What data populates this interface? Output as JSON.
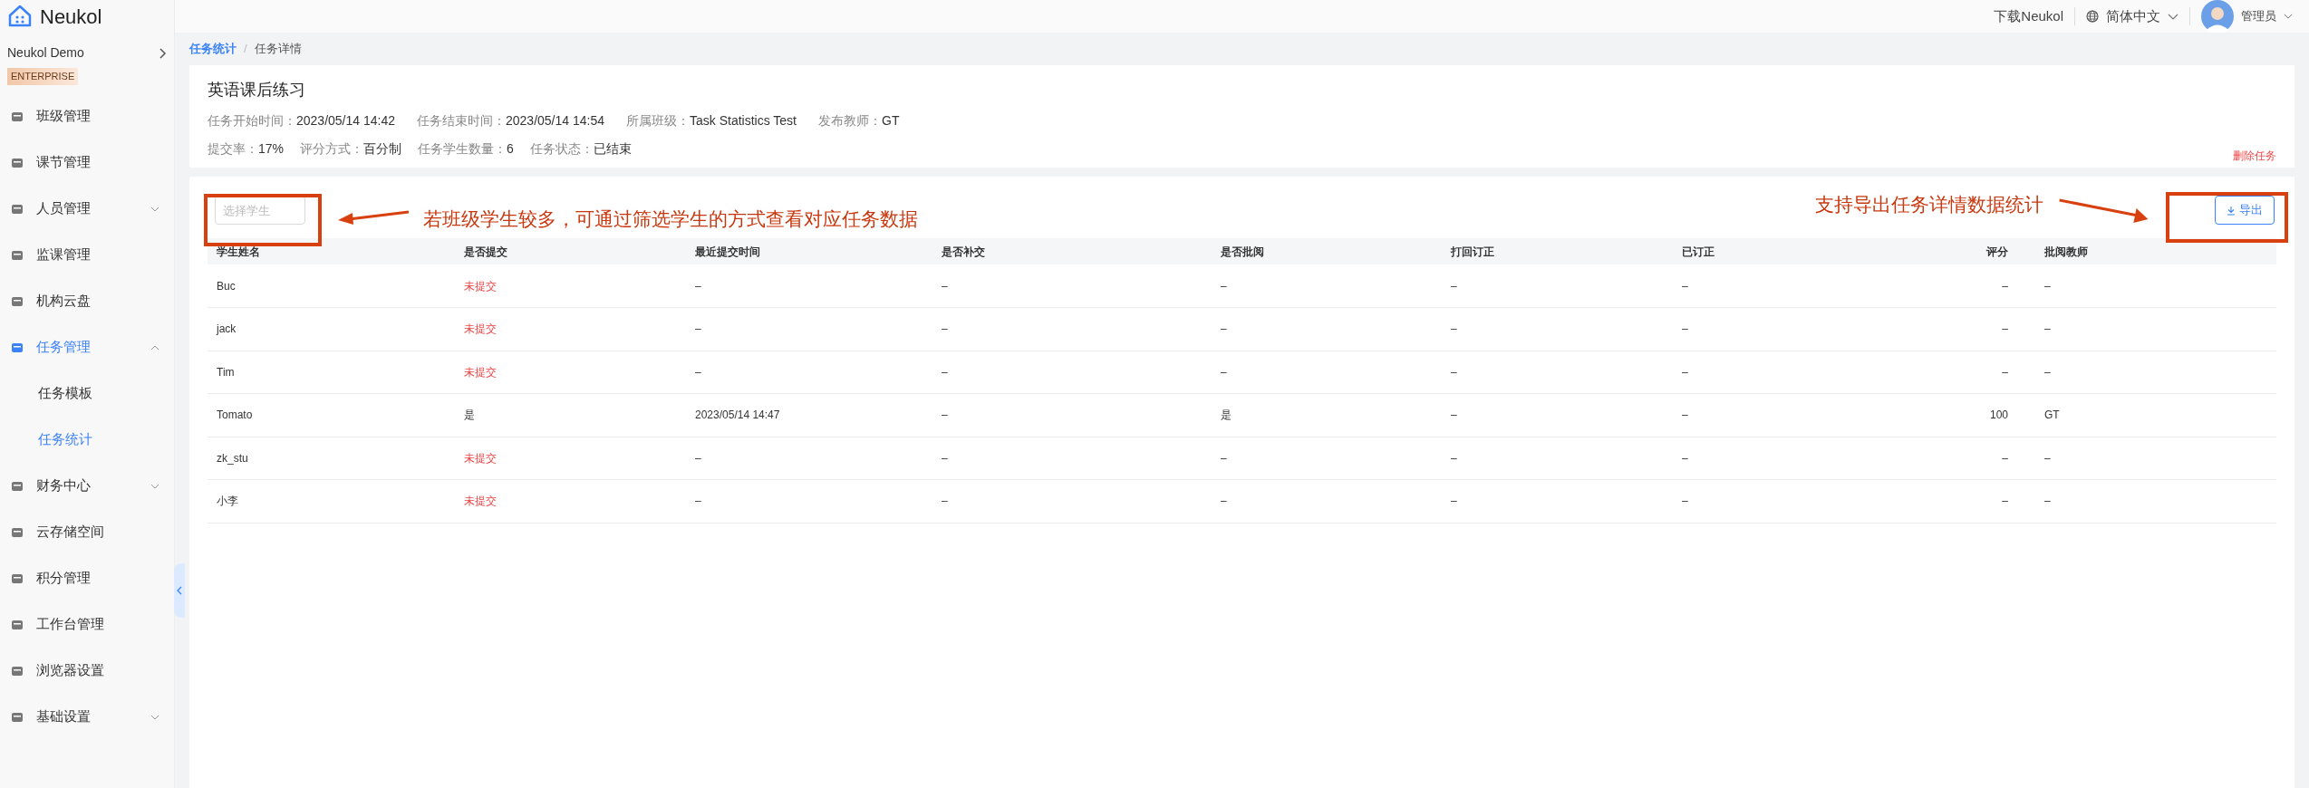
{
  "app": {
    "logo_text": "Neukol",
    "org_name": "Neukol Demo",
    "org_badge": "ENTERPRISE"
  },
  "header": {
    "download_link": "下载Neukol",
    "language": "简体中文",
    "user": "管理员"
  },
  "sidebar": {
    "items": [
      {
        "kind": "link",
        "label": "班级管理",
        "selected": false
      },
      {
        "kind": "link",
        "label": "课节管理",
        "selected": false
      },
      {
        "kind": "group",
        "label": "人员管理",
        "expanded": false
      },
      {
        "kind": "link",
        "label": "监课管理",
        "selected": false
      },
      {
        "kind": "link",
        "label": "机构云盘",
        "selected": false
      },
      {
        "kind": "group",
        "label": "任务管理",
        "expanded": true,
        "children": [
          {
            "label": "任务模板",
            "selected": false
          },
          {
            "label": "任务统计",
            "selected": true
          }
        ]
      },
      {
        "kind": "group",
        "label": "财务中心",
        "expanded": false
      },
      {
        "kind": "link",
        "label": "云存储空间",
        "selected": false
      },
      {
        "kind": "link",
        "label": "积分管理",
        "selected": false
      },
      {
        "kind": "link",
        "label": "工作台管理",
        "selected": false
      },
      {
        "kind": "link",
        "label": "浏览器设置",
        "selected": false
      },
      {
        "kind": "group",
        "label": "基础设置",
        "expanded": false
      }
    ]
  },
  "breadcrumb_separator": "/",
  "breadcrumb": [
    {
      "label": "任务统计",
      "selected": false
    },
    {
      "label": "任务详情",
      "selected": true
    }
  ],
  "task": {
    "title": "英语课后练习",
    "fields_line_1": [
      {
        "label": "任务开始时间：",
        "value": "2023/05/14 14:42"
      },
      {
        "label": "任务结束时间：",
        "value": "2023/05/14 14:54"
      },
      {
        "label": "所属班级：",
        "value": "Task Statistics Test"
      },
      {
        "label": "发布教师：",
        "value": "GT"
      }
    ],
    "fields_line_2": [
      {
        "label": "提交率：",
        "value": "17%"
      },
      {
        "label": "评分方式：",
        "value": "百分制"
      },
      {
        "label": "任务学生数量：",
        "value": "6"
      },
      {
        "label": "任务状态：",
        "value": "已结束"
      }
    ],
    "delete_link": "删除任务"
  },
  "filter": {
    "placeholder": "选择学生"
  },
  "export_button": "导出",
  "annotations": [
    "若班级学生较多，可通过筛选学生的方式查看对应任务数据",
    "支持导出任务详情数据统计"
  ],
  "table": {
    "columns": [
      "学生姓名",
      "是否提交",
      "最近提交时间",
      "是否补交",
      "是否批阅",
      "打回订正",
      "已订正",
      "评分",
      "批阅教师"
    ],
    "rows": [
      {
        "submitted": false,
        "cells": [
          "Buc",
          "未提交",
          "–",
          "–",
          "–",
          "–",
          "–",
          "–",
          "–"
        ]
      },
      {
        "submitted": false,
        "cells": [
          "jack",
          "未提交",
          "–",
          "–",
          "–",
          "–",
          "–",
          "–",
          "–"
        ]
      },
      {
        "submitted": false,
        "cells": [
          "Tim",
          "未提交",
          "–",
          "–",
          "–",
          "–",
          "–",
          "–",
          "–"
        ]
      },
      {
        "submitted": true,
        "cells": [
          "Tomato",
          "是",
          "2023/05/14 14:47",
          "–",
          "是",
          "–",
          "–",
          "100",
          "GT"
        ]
      },
      {
        "submitted": false,
        "cells": [
          "zk_stu",
          "未提交",
          "–",
          "–",
          "–",
          "–",
          "–",
          "–",
          "–"
        ]
      },
      {
        "submitted": false,
        "cells": [
          "小李",
          "未提交",
          "–",
          "–",
          "–",
          "–",
          "–",
          "–",
          "–"
        ]
      }
    ]
  }
}
